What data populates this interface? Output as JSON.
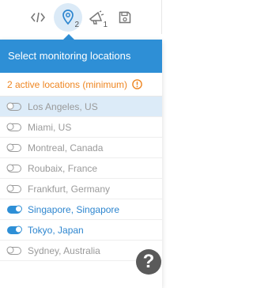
{
  "toolbar": {
    "location_count": "2",
    "alert_count": "1"
  },
  "panel": {
    "title": "Select monitoring locations",
    "warning": "2 active locations (minimum)",
    "locations": [
      {
        "name": "Los Angeles, US",
        "active": false
      },
      {
        "name": "Miami, US",
        "active": false
      },
      {
        "name": "Montreal, Canada",
        "active": false
      },
      {
        "name": "Roubaix, France",
        "active": false
      },
      {
        "name": "Frankfurt, Germany",
        "active": false
      },
      {
        "name": "Singapore, Singapore",
        "active": true
      },
      {
        "name": "Tokyo, Japan",
        "active": true
      },
      {
        "name": "Sydney, Australia",
        "active": false
      }
    ]
  },
  "help": {
    "icon": "question-icon",
    "glyph": "?"
  },
  "colors": {
    "accent": "#2e8fd6",
    "warning": "#ee8622",
    "inactive_text": "#9a9a9a"
  }
}
